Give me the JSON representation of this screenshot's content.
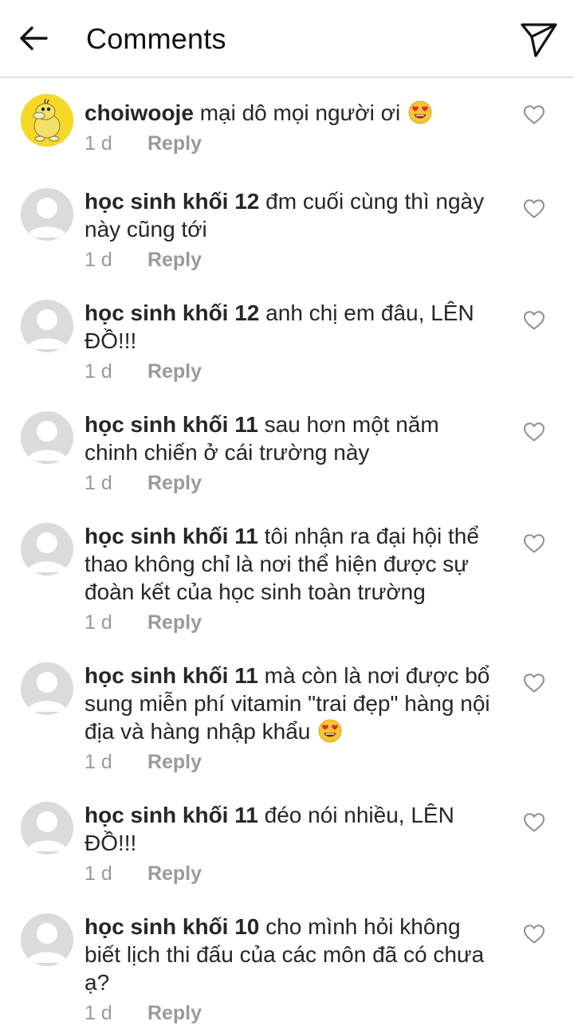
{
  "header": {
    "title": "Comments"
  },
  "comments": [
    {
      "username": "choiwooje",
      "text": "mại dô mọi người ơi",
      "emoji": "heart-eyes-emoji",
      "time": "1 d",
      "reply": "Reply",
      "avatar": "custom-avatar"
    },
    {
      "username": "học sinh khối 12",
      "text": "đm cuối cùng thì ngày này cũng tới",
      "time": "1 d",
      "reply": "Reply",
      "avatar": "default-avatar"
    },
    {
      "username": "học sinh khối 12",
      "text": "anh chị em đâu, LÊN ĐỒ!!!",
      "time": "1 d",
      "reply": "Reply",
      "avatar": "default-avatar"
    },
    {
      "username": "học sinh khối 11",
      "text": "sau hơn một năm chinh chiến ở cái trường này",
      "time": "1 d",
      "reply": "Reply",
      "avatar": "default-avatar"
    },
    {
      "username": "học sinh khối 11",
      "text": "tôi nhận ra đại hội thể thao không chỉ là nơi thể hiện được sự đoàn kết của học sinh toàn trường",
      "time": "1 d",
      "reply": "Reply",
      "avatar": "default-avatar"
    },
    {
      "username": "học sinh khối 11",
      "text": "mà còn là nơi được bổ sung miễn phí vitamin \"trai đẹp\" hàng nội địa và hàng nhập khẩu",
      "emoji": "heart-eyes-emoji",
      "time": "1 d",
      "reply": "Reply",
      "avatar": "default-avatar"
    },
    {
      "username": "học sinh khối 11",
      "text": "đéo nói nhiều, LÊN ĐỒ!!!",
      "time": "1 d",
      "reply": "Reply",
      "avatar": "default-avatar"
    },
    {
      "username": "học sinh khối 10",
      "text": "cho mình hỏi không biết lịch thi đấu của các môn đã có chưa ạ?",
      "time": "1 d",
      "reply": "Reply",
      "avatar": "default-avatar"
    }
  ]
}
